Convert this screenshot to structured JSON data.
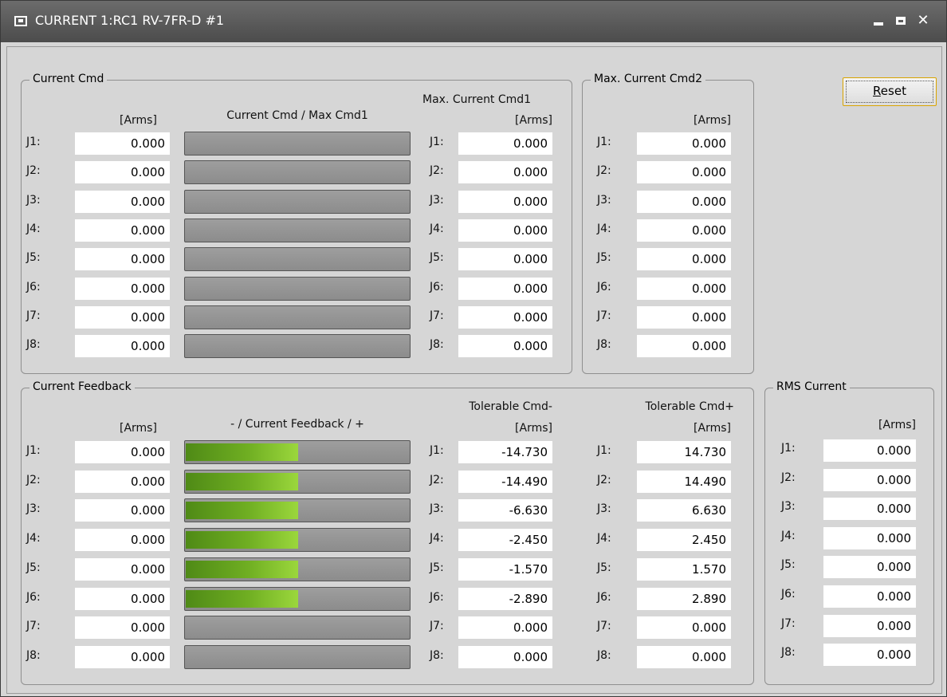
{
  "window": {
    "title": "CURRENT 1:RC1 RV-7FR-D #1"
  },
  "reset_button": {
    "label_underlined": "R",
    "label_rest": "eset"
  },
  "current_cmd": {
    "group_title": "Current Cmd",
    "unit_header": "[Arms]",
    "bar_header": "Current Cmd / Max Cmd1",
    "rows": [
      {
        "label": "J1:",
        "value": "0.000",
        "bar_fraction": 0
      },
      {
        "label": "J2:",
        "value": "0.000",
        "bar_fraction": 0
      },
      {
        "label": "J3:",
        "value": "0.000",
        "bar_fraction": 0
      },
      {
        "label": "J4:",
        "value": "0.000",
        "bar_fraction": 0
      },
      {
        "label": "J5:",
        "value": "0.000",
        "bar_fraction": 0
      },
      {
        "label": "J6:",
        "value": "0.000",
        "bar_fraction": 0
      },
      {
        "label": "J7:",
        "value": "0.000",
        "bar_fraction": 0
      },
      {
        "label": "J8:",
        "value": "0.000",
        "bar_fraction": 0
      }
    ],
    "max_cmd1_header": "Max. Current Cmd1",
    "max_cmd1_unit": "[Arms]",
    "max_cmd1_rows": [
      {
        "label": "J1:",
        "value": "0.000"
      },
      {
        "label": "J2:",
        "value": "0.000"
      },
      {
        "label": "J3:",
        "value": "0.000"
      },
      {
        "label": "J4:",
        "value": "0.000"
      },
      {
        "label": "J5:",
        "value": "0.000"
      },
      {
        "label": "J6:",
        "value": "0.000"
      },
      {
        "label": "J7:",
        "value": "0.000"
      },
      {
        "label": "J8:",
        "value": "0.000"
      }
    ]
  },
  "max_cmd2": {
    "group_title": "Max. Current Cmd2",
    "unit_header": "[Arms]",
    "rows": [
      {
        "label": "J1:",
        "value": "0.000"
      },
      {
        "label": "J2:",
        "value": "0.000"
      },
      {
        "label": "J3:",
        "value": "0.000"
      },
      {
        "label": "J4:",
        "value": "0.000"
      },
      {
        "label": "J5:",
        "value": "0.000"
      },
      {
        "label": "J6:",
        "value": "0.000"
      },
      {
        "label": "J7:",
        "value": "0.000"
      },
      {
        "label": "J8:",
        "value": "0.000"
      }
    ]
  },
  "current_feedback": {
    "group_title": "Current Feedback",
    "unit_header": "[Arms]",
    "bar_header": "- / Current Feedback / +",
    "rows": [
      {
        "label": "J1:",
        "value": "0.000",
        "bar_fraction": 0.5
      },
      {
        "label": "J2:",
        "value": "0.000",
        "bar_fraction": 0.5
      },
      {
        "label": "J3:",
        "value": "0.000",
        "bar_fraction": 0.5
      },
      {
        "label": "J4:",
        "value": "0.000",
        "bar_fraction": 0.5
      },
      {
        "label": "J5:",
        "value": "0.000",
        "bar_fraction": 0.5
      },
      {
        "label": "J6:",
        "value": "0.000",
        "bar_fraction": 0.5
      },
      {
        "label": "J7:",
        "value": "0.000",
        "bar_fraction": 0
      },
      {
        "label": "J8:",
        "value": "0.000",
        "bar_fraction": 0
      }
    ],
    "tol_minus_header": "Tolerable Cmd-",
    "tol_minus_unit": "[Arms]",
    "tol_minus_rows": [
      {
        "label": "J1:",
        "value": "-14.730"
      },
      {
        "label": "J2:",
        "value": "-14.490"
      },
      {
        "label": "J3:",
        "value": "-6.630"
      },
      {
        "label": "J4:",
        "value": "-2.450"
      },
      {
        "label": "J5:",
        "value": "-1.570"
      },
      {
        "label": "J6:",
        "value": "-2.890"
      },
      {
        "label": "J7:",
        "value": "0.000"
      },
      {
        "label": "J8:",
        "value": "0.000"
      }
    ],
    "tol_plus_header": "Tolerable Cmd+",
    "tol_plus_unit": "[Arms]",
    "tol_plus_rows": [
      {
        "label": "J1:",
        "value": "14.730"
      },
      {
        "label": "J2:",
        "value": "14.490"
      },
      {
        "label": "J3:",
        "value": "6.630"
      },
      {
        "label": "J4:",
        "value": "2.450"
      },
      {
        "label": "J5:",
        "value": "1.570"
      },
      {
        "label": "J6:",
        "value": "2.890"
      },
      {
        "label": "J7:",
        "value": "0.000"
      },
      {
        "label": "J8:",
        "value": "0.000"
      }
    ]
  },
  "rms_current": {
    "group_title": "RMS Current",
    "unit_header": "[Arms]",
    "rows": [
      {
        "label": "J1:",
        "value": "0.000"
      },
      {
        "label": "J2:",
        "value": "0.000"
      },
      {
        "label": "J3:",
        "value": "0.000"
      },
      {
        "label": "J4:",
        "value": "0.000"
      },
      {
        "label": "J5:",
        "value": "0.000"
      },
      {
        "label": "J6:",
        "value": "0.000"
      },
      {
        "label": "J7:",
        "value": "0.000"
      },
      {
        "label": "J8:",
        "value": "0.000"
      }
    ]
  }
}
